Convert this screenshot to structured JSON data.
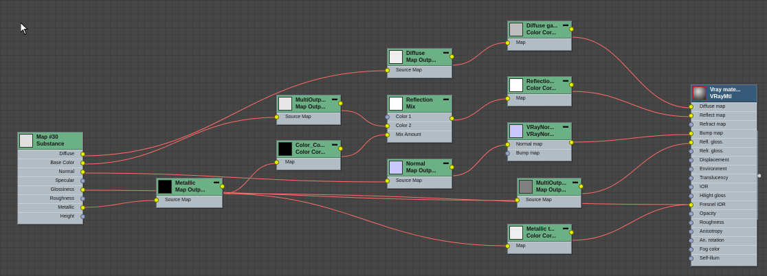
{
  "colors": {
    "wire": "#ff6a6a",
    "node_header": "#6cb086",
    "vray_header": "#375a78",
    "socket_lit": "#e8f000",
    "socket_empty": "#9aa6c8"
  },
  "nodes": {
    "substance": {
      "title": "Map #30",
      "subtitle": "Substance",
      "swatch": "#e0e0e0",
      "outputs": [
        "Diffuse",
        "Base Color",
        "Normal",
        "Specular",
        "Glossiness",
        "Roughness",
        "Metallic",
        "Height"
      ]
    },
    "metallic_output": {
      "title": "Metallic",
      "subtitle": "Map Outp...",
      "swatch": "#000000",
      "input": "Source Map"
    },
    "multioutput_1": {
      "title": "MultiOutp...",
      "subtitle": "Map Outp...",
      "swatch": "#e8e8e8",
      "input": "Source Map"
    },
    "color_correct_1": {
      "title": "Color_Co...",
      "subtitle": "Color Cor...",
      "swatch": "#000000",
      "input": "Map"
    },
    "diffuse_output": {
      "title": "Diffuse",
      "subtitle": "Map Outp...",
      "swatch": "#eeeeee",
      "input": "Source Map"
    },
    "reflection_mix": {
      "title": "Reflection",
      "subtitle": "Mix",
      "swatch": "#ffffff",
      "inputs": [
        "Color 1",
        "Color 2",
        "Mix Amount"
      ]
    },
    "normal_output": {
      "title": "Normal",
      "subtitle": "Map Outp...",
      "swatch": "#c8c8ff",
      "input": "Source Map"
    },
    "diffuse_gamma": {
      "title": "Diffuse ga...",
      "subtitle": "Color Cor...",
      "swatch": "#bdbdbd",
      "input": "Map"
    },
    "reflection_cc": {
      "title": "Reflectio...",
      "subtitle": "Color Cor...",
      "swatch": "#ffffff",
      "input": "Map"
    },
    "vraynormal": {
      "title": "VRayNor...",
      "subtitle": "VRayNor...",
      "swatch": "#c8c8ff",
      "inputs": [
        "Normal map",
        "Bump map"
      ]
    },
    "multioutput_2": {
      "title": "MultiOutp...",
      "subtitle": "Map Outp...",
      "swatch": "#808080",
      "input": "Source Map"
    },
    "metallic_cc": {
      "title": "Metallic t...",
      "subtitle": "Color Cor...",
      "swatch": "#eeeeee",
      "input": "Map"
    },
    "vray_material": {
      "title": "Vray mate...",
      "subtitle": "VRayMtl",
      "inputs": [
        "Diffuse map",
        "Reflect map",
        "Refract map",
        "Bump map",
        "Refl. gloss.",
        "Refr. gloss.",
        "Displacement",
        "Environment",
        "Translucency",
        "IOR",
        "Hilight gloss",
        "Fresnel IOR",
        "Opacity",
        "Roughness",
        "Anisotropy",
        "An. rotation",
        "Fog color",
        "Self-illum"
      ]
    }
  }
}
